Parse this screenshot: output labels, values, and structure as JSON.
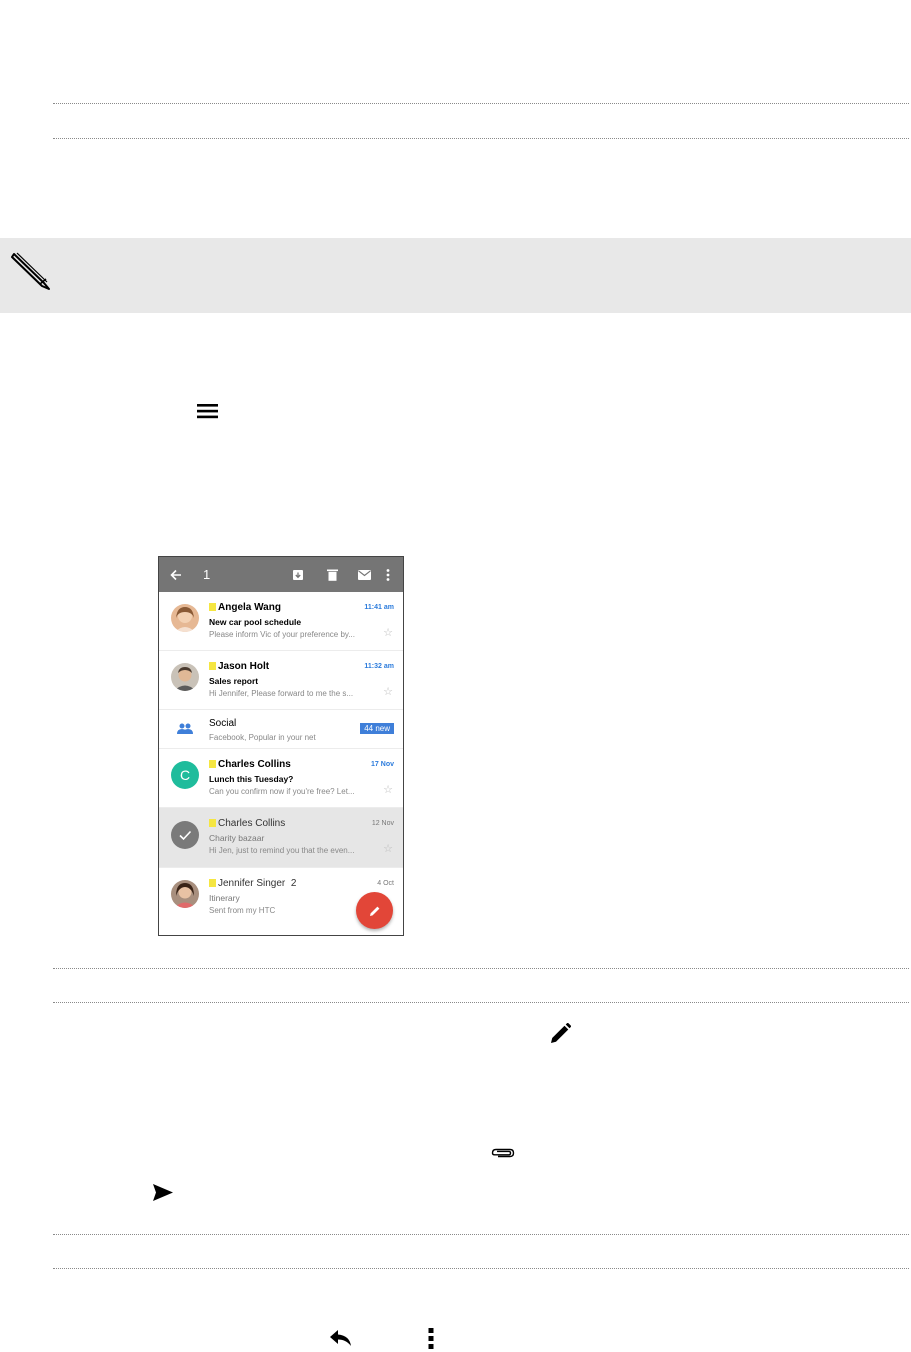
{
  "phone": {
    "toolbar": {
      "count": "1"
    },
    "emails": [
      {
        "sender": "Angela Wang",
        "time": "11:41 am",
        "subject": "New car pool schedule",
        "snippet": "Please inform Vic of your preference by...",
        "unread": true,
        "avatar": "photo",
        "avatar_color": "#d8a07a"
      },
      {
        "sender": "Jason Holt",
        "time": "11:32 am",
        "subject": "Sales report",
        "snippet": "Hi Jennifer, Please forward to me the s...",
        "unread": true,
        "avatar": "photo",
        "avatar_color": "#8a7a6a"
      },
      {
        "sender": "Social",
        "badge": "44 new",
        "snippet": "Facebook, Popular in your net",
        "avatar": "people-icon"
      },
      {
        "sender": "Charles Collins",
        "time": "17 Nov",
        "subject": "Lunch this Tuesday?",
        "snippet": "Can you confirm now if you're free? Let...",
        "unread": true,
        "avatar_letter": "C",
        "avatar_color": "#1fbc9c"
      },
      {
        "sender": "Charles Collins",
        "time": "12 Nov",
        "subject": "Charity bazaar",
        "snippet": "Hi Jen, just to remind you that the even...",
        "unread": false,
        "selected": true,
        "avatar": "check-icon",
        "avatar_color": "#7a7a7a"
      },
      {
        "sender": "Jennifer Singer",
        "count": "2",
        "time": "4 Oct",
        "subject": "Itinerary",
        "snippet": "Sent from my HTC",
        "unread": false,
        "avatar": "photo",
        "avatar_color": "#6b4a3a"
      }
    ]
  },
  "colors": {
    "toolbar": "#757575",
    "accent_blue": "#2b7bdc",
    "fab": "#e24638",
    "note_bg": "#e8e8e8"
  }
}
